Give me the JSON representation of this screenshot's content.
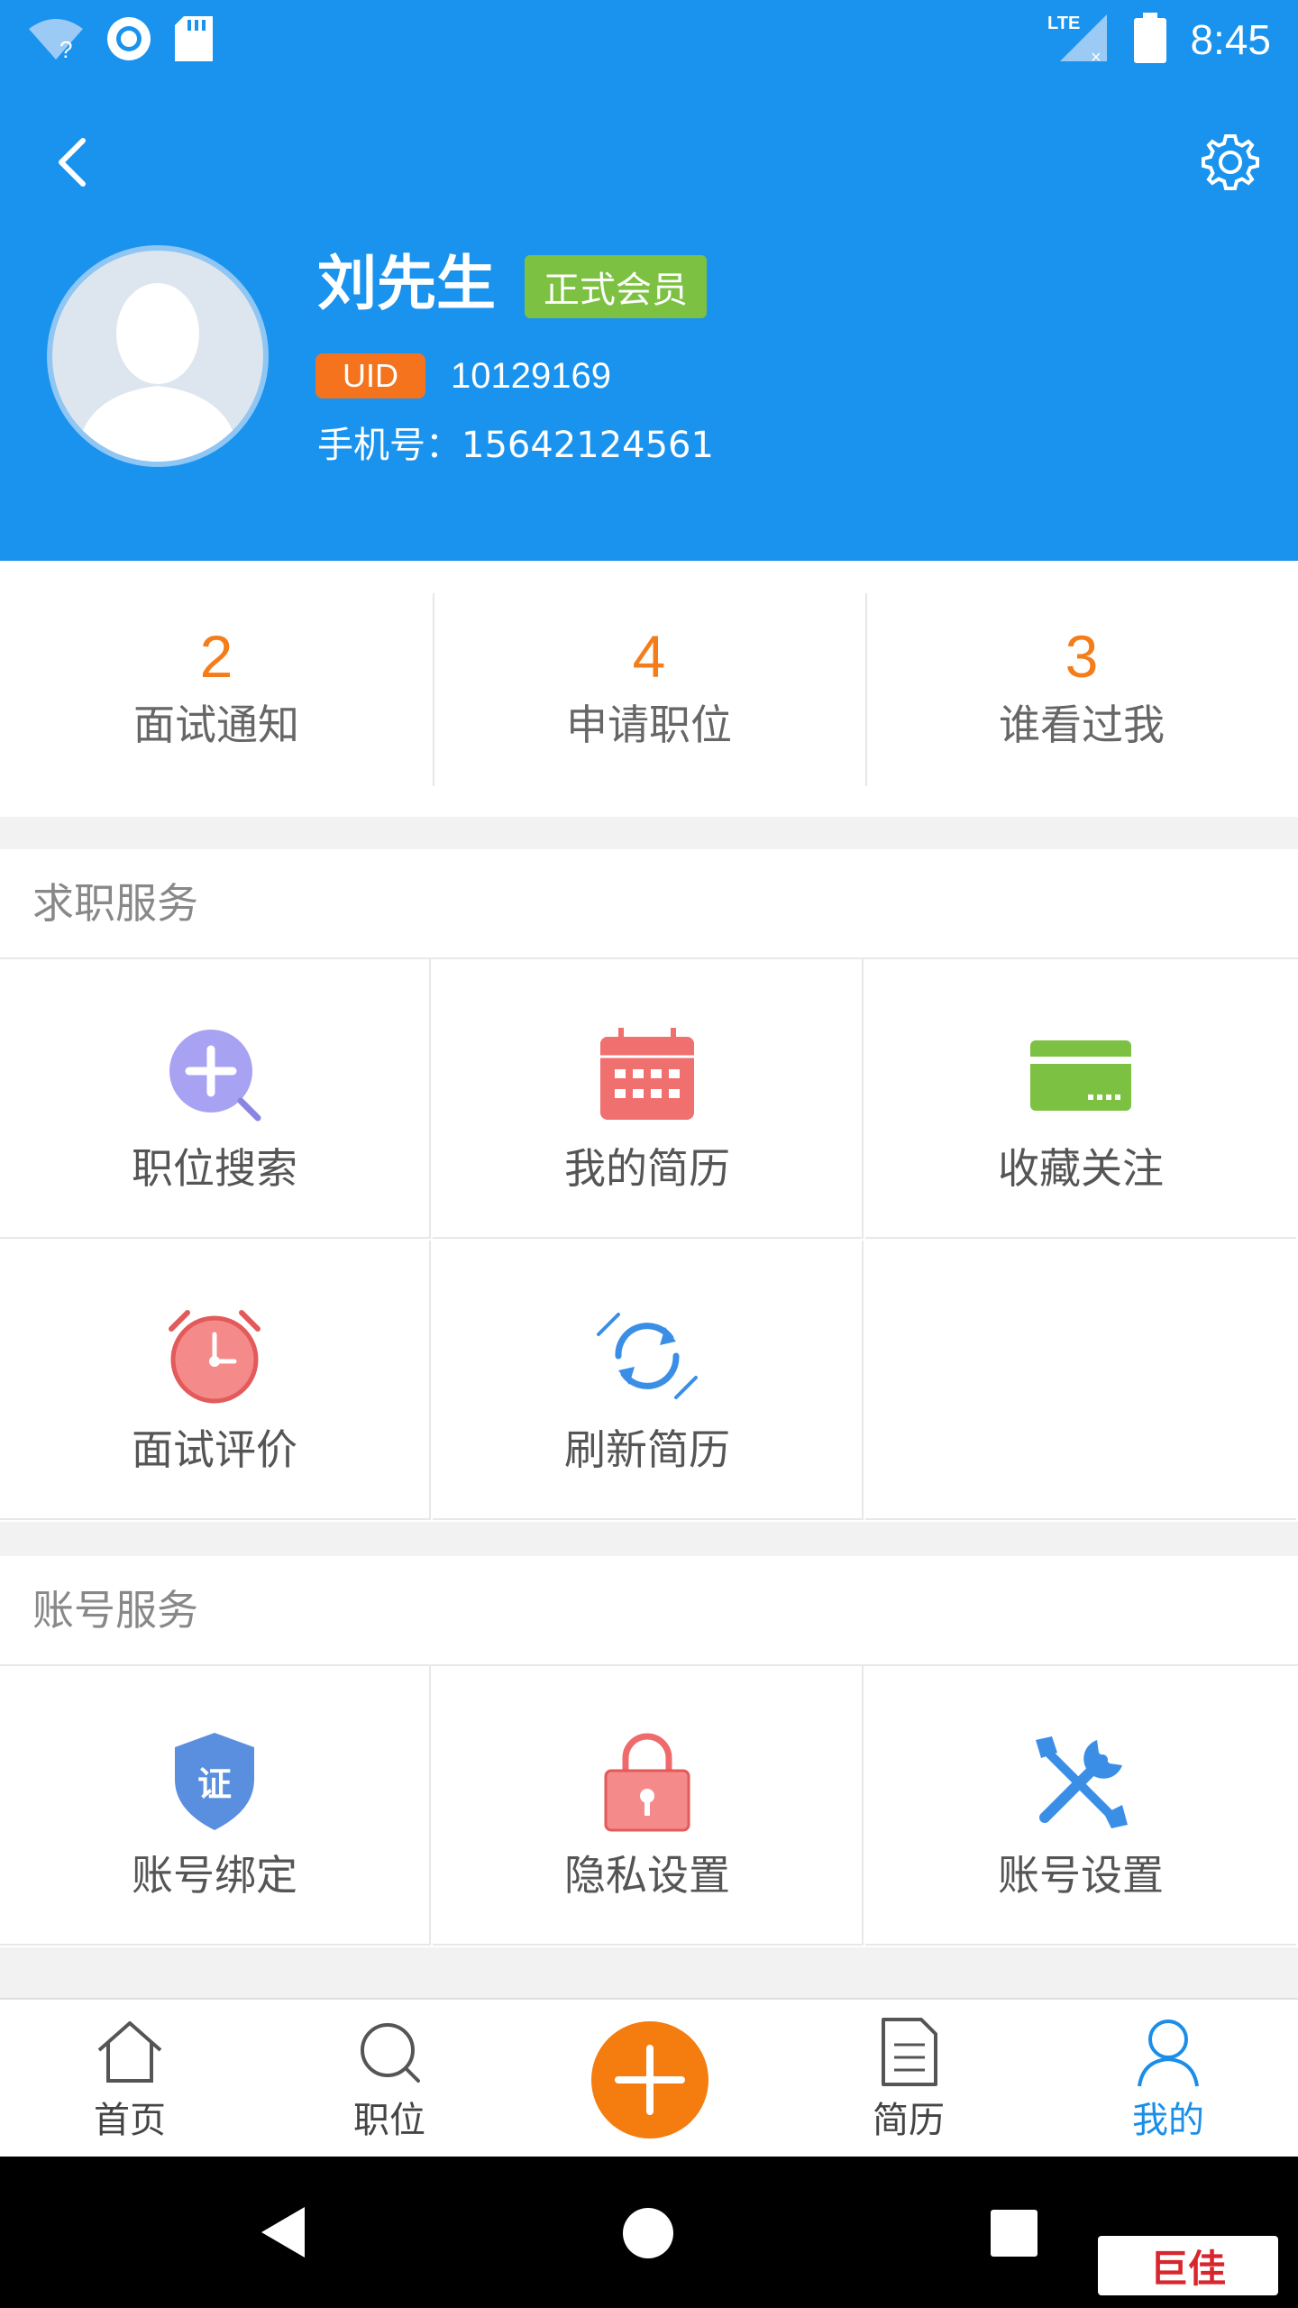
{
  "status_bar": {
    "time": "8:45",
    "network": "LTE"
  },
  "profile": {
    "name": "刘先生",
    "member_badge": "正式会员",
    "uid_label": "UID",
    "uid_value": "10129169",
    "phone_label": "手机号：",
    "phone_value": "15642124561"
  },
  "stats": [
    {
      "count": "2",
      "label": "面试通知"
    },
    {
      "count": "4",
      "label": "申请职位"
    },
    {
      "count": "3",
      "label": "谁看过我"
    }
  ],
  "job_services": {
    "title": "求职服务",
    "items": [
      {
        "label": "职位搜索",
        "icon": "search-plus-icon"
      },
      {
        "label": "我的简历",
        "icon": "calendar-icon"
      },
      {
        "label": "收藏关注",
        "icon": "card-icon"
      },
      {
        "label": "面试评价",
        "icon": "alarm-clock-icon"
      },
      {
        "label": "刷新简历",
        "icon": "refresh-icon"
      }
    ]
  },
  "account_services": {
    "title": "账号服务",
    "items": [
      {
        "label": "账号绑定",
        "icon": "shield-icon",
        "icon_text": "证"
      },
      {
        "label": "隐私设置",
        "icon": "lock-icon"
      },
      {
        "label": "账号设置",
        "icon": "tools-icon"
      }
    ]
  },
  "tabbar": {
    "items": [
      {
        "label": "首页",
        "icon": "home-icon"
      },
      {
        "label": "职位",
        "icon": "search-icon"
      },
      {
        "label": "简历",
        "icon": "document-icon"
      },
      {
        "label": "我的",
        "icon": "user-icon",
        "active": true
      }
    ]
  },
  "watermark": "巨佳",
  "colors": {
    "header": "#1a93ee",
    "accent_orange": "#f47d1a",
    "member_green": "#7cc142",
    "active_tab": "#1a8ee8"
  }
}
